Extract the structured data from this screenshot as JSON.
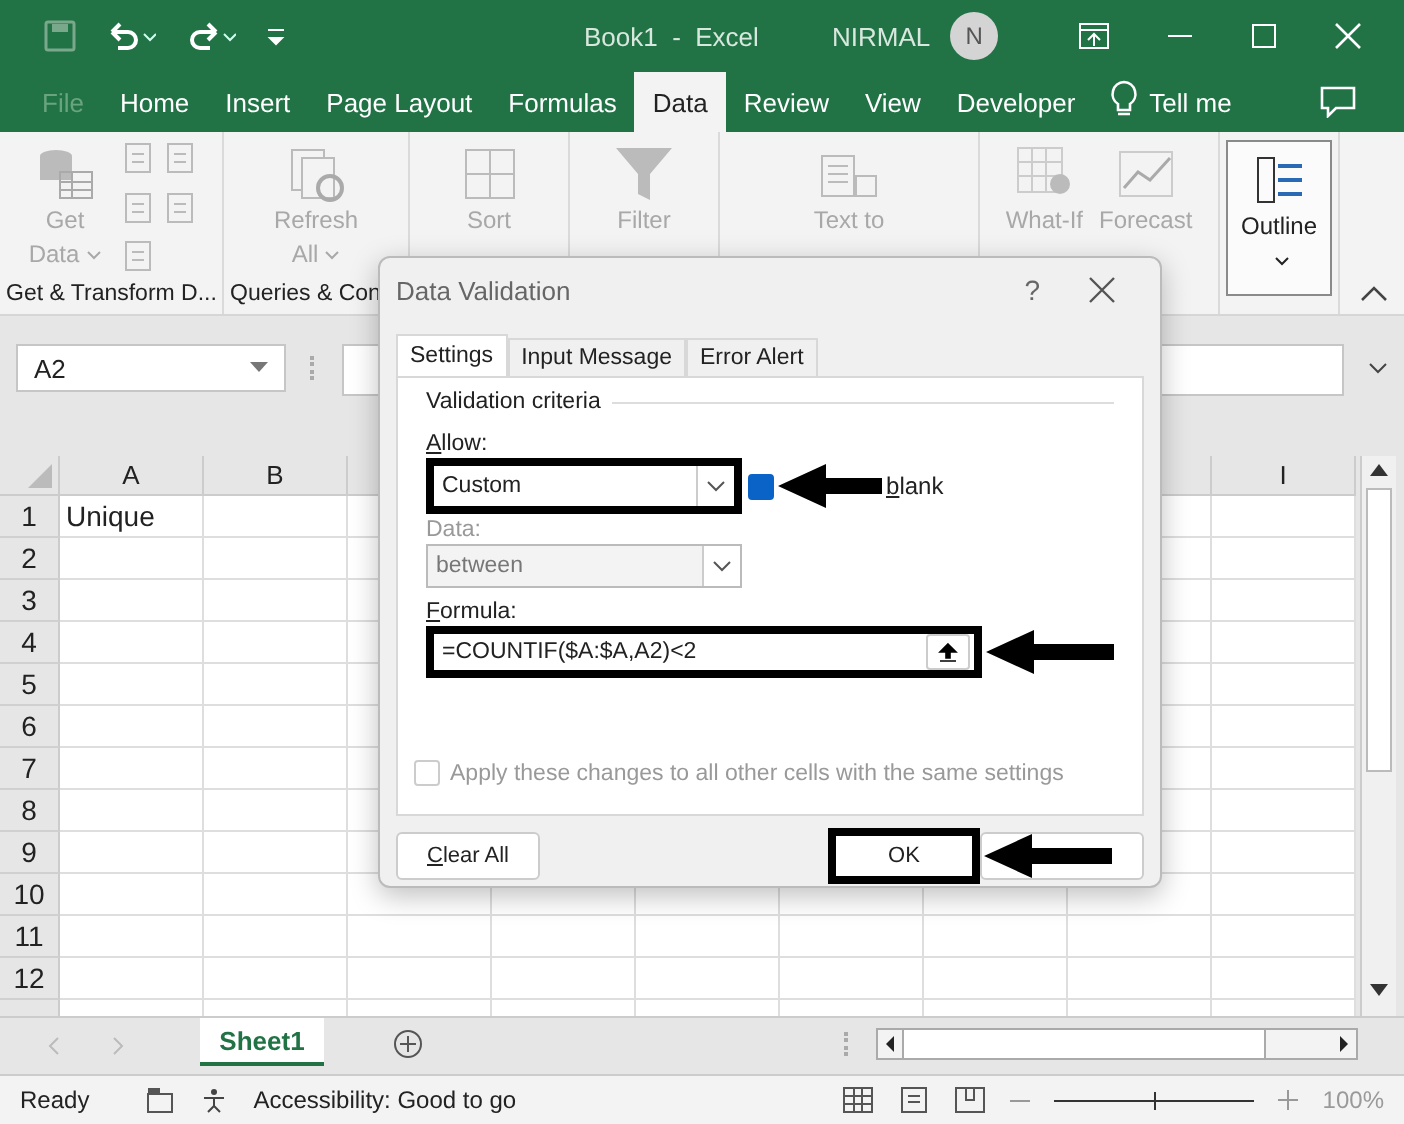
{
  "title_bar": {
    "title": "Book1  -  Excel",
    "user": "NIRMAL",
    "avatar_initial": "N"
  },
  "ribbon_tabs": [
    {
      "label": "File",
      "selected": false,
      "disabled": true
    },
    {
      "label": "Home",
      "selected": false,
      "disabled": false
    },
    {
      "label": "Insert",
      "selected": false,
      "disabled": false
    },
    {
      "label": "Page Layout",
      "selected": false,
      "disabled": false
    },
    {
      "label": "Formulas",
      "selected": false,
      "disabled": false
    },
    {
      "label": "Data",
      "selected": true,
      "disabled": false
    },
    {
      "label": "Review",
      "selected": false,
      "disabled": false
    },
    {
      "label": "View",
      "selected": false,
      "disabled": false
    },
    {
      "label": "Developer",
      "selected": false,
      "disabled": false
    }
  ],
  "tell_me": "Tell me",
  "ribbon_groups": [
    {
      "label": "Get & Transform D...",
      "commands": [
        {
          "label": "Get Data",
          "dropdown": true,
          "disabled": true
        }
      ]
    },
    {
      "label": "Queries & Con",
      "commands": [
        {
          "label": "Refresh All",
          "dropdown": true,
          "disabled": true
        }
      ]
    },
    {
      "commands": [
        {
          "label": "Sort",
          "dropdown": false,
          "disabled": true
        }
      ]
    },
    {
      "commands": [
        {
          "label": "Filter",
          "dropdown": false,
          "disabled": true
        }
      ]
    },
    {
      "commands": [
        {
          "label": "Text to",
          "dropdown": false,
          "disabled": true
        }
      ]
    },
    {
      "commands": [
        {
          "label": "What-If",
          "dropdown": false,
          "disabled": true
        },
        {
          "label": "Forecast",
          "dropdown": false,
          "disabled": true
        }
      ]
    },
    {
      "commands": [
        {
          "label": "Outline",
          "dropdown": true,
          "disabled": false
        }
      ]
    }
  ],
  "name_box": "A2",
  "columns": [
    {
      "label": "A"
    },
    {
      "label": "B"
    },
    {
      "label": "I"
    }
  ],
  "rows": [
    {
      "number": "1",
      "cells": [
        "Unique"
      ]
    },
    {
      "number": "2"
    },
    {
      "number": "3"
    },
    {
      "number": "4"
    },
    {
      "number": "5"
    },
    {
      "number": "6"
    },
    {
      "number": "7"
    },
    {
      "number": "8"
    },
    {
      "number": "9"
    },
    {
      "number": "10"
    },
    {
      "number": "11"
    },
    {
      "number": "12"
    }
  ],
  "sheet_tabs": [
    {
      "label": "Sheet1",
      "selected": true
    }
  ],
  "status_bar": {
    "mode": "Ready",
    "accessibility": "Accessibility: Good to go",
    "zoom": "100%",
    "zoom_slider": {
      "level": 0.5
    }
  },
  "dialog": {
    "title": "Data Validation",
    "help": "?",
    "tabs": [
      {
        "label": "Settings",
        "selected": true
      },
      {
        "label": "Input Message",
        "selected": false
      },
      {
        "label": "Error Alert",
        "selected": false
      }
    ],
    "group_title": "Validation criteria",
    "allow": {
      "label": "Allow:",
      "value": "Custom",
      "annotated": true
    },
    "ignore_blank": {
      "label": "blank",
      "checked": true
    },
    "data": {
      "label": "Data:",
      "value": "between",
      "disabled": true
    },
    "formula": {
      "label": "Formula:",
      "value": "=COUNTIF($A:$A,A2)<2",
      "annotated": true
    },
    "apply_all": {
      "label": "Apply these changes to all other cells with the same settings",
      "checked": false,
      "disabled": true
    },
    "buttons": [
      {
        "label": "Clear All",
        "annotated": false
      },
      {
        "label": "OK",
        "annotated": true
      },
      {
        "annotated": true
      }
    ]
  }
}
